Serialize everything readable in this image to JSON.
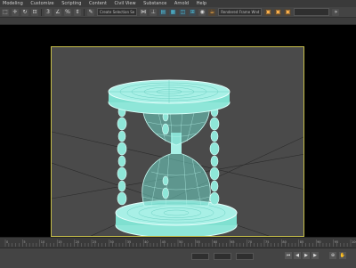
{
  "menu": {
    "items": [
      "Modeling",
      "Customize",
      "Scripting",
      "Content",
      "Civil View",
      "Substance",
      "Arnold",
      "Help"
    ]
  },
  "toolbar": {
    "selection_set": "Create Selection Se",
    "render_preset": "Rendered Frame Wnd"
  },
  "timeline": {
    "ticks": [
      "0",
      "5",
      "10",
      "15",
      "20",
      "25",
      "30",
      "35",
      "40",
      "45",
      "50",
      "55",
      "60",
      "65",
      "70",
      "75",
      "80",
      "85",
      "90",
      "95",
      "100"
    ]
  },
  "colors": {
    "viewport_bg": "#4a4a4a",
    "viewport_border": "#c8c04a",
    "wire": "#7fe0d0",
    "wire_dense": "#b6f3ea"
  }
}
